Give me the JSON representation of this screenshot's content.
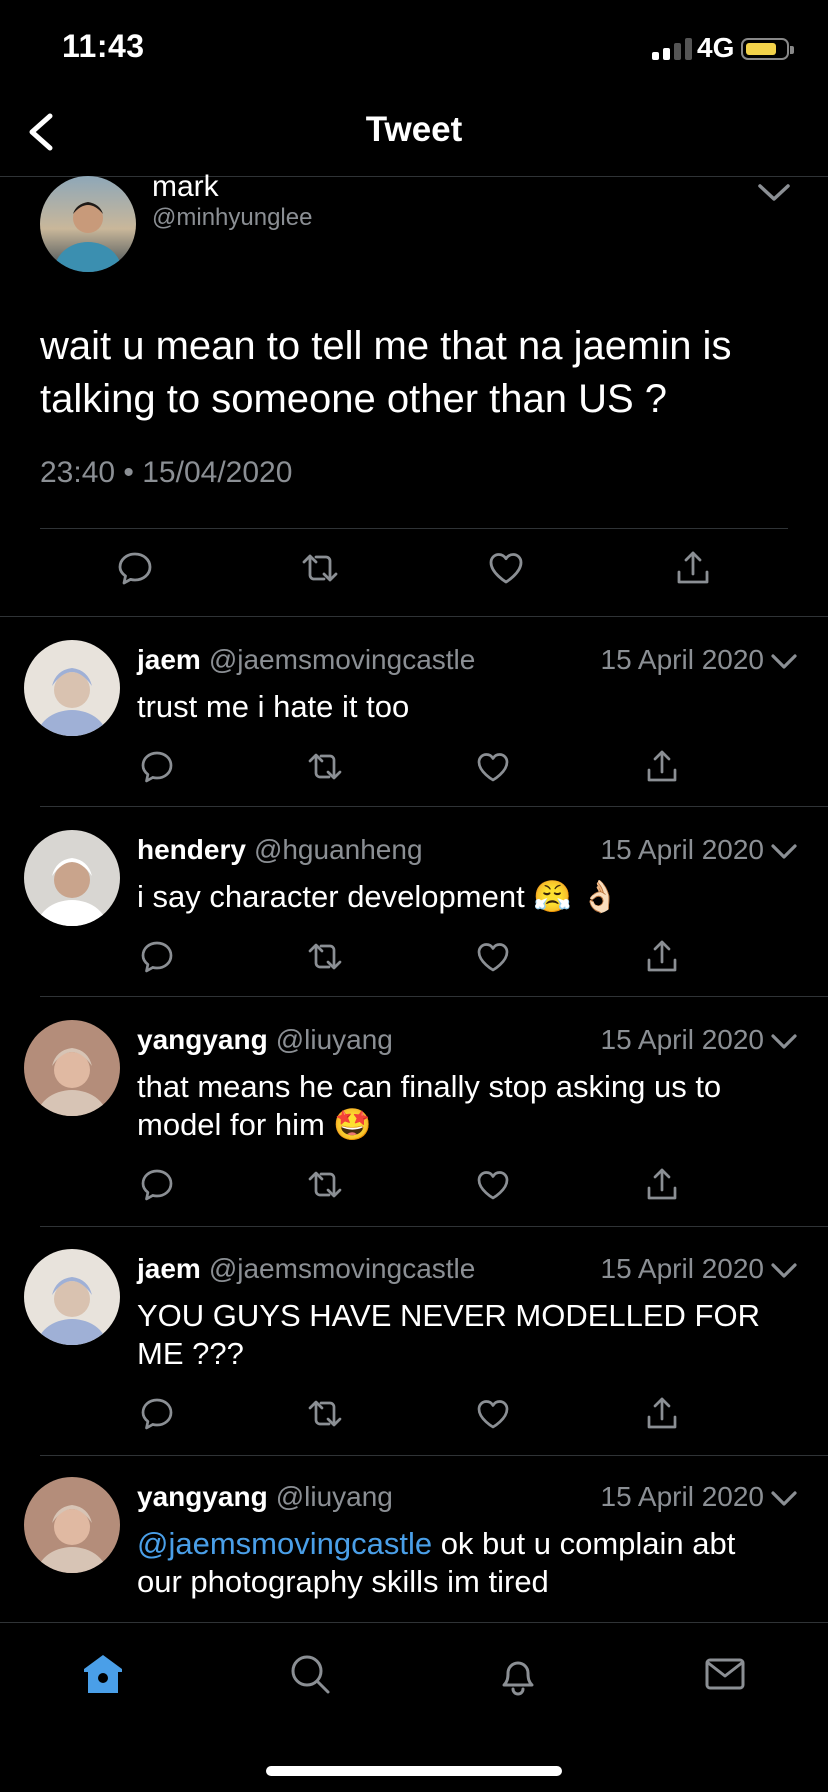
{
  "status_bar": {
    "time": "11:43",
    "network": "4G"
  },
  "header": {
    "title": "Tweet"
  },
  "main_tweet": {
    "name": "mark",
    "handle": "@minhyunglee",
    "text": "wait u mean to tell me that na jaemin is talking to someone other than US ?",
    "meta": "23:40 • 15/04/2020"
  },
  "replies": [
    {
      "name": "jaem",
      "handle": "@jaemsmovingcastle",
      "date": "15 April 2020",
      "mention": "",
      "text": "trust me i hate it too"
    },
    {
      "name": "hendery",
      "handle": "@hguanheng",
      "date": "15 April 2020",
      "mention": "",
      "text": "i say character development 😤 👌🏻"
    },
    {
      "name": "yangyang",
      "handle": "@liuyang",
      "date": "15 April 2020",
      "mention": "",
      "text": "that means he can finally stop asking us to model for him 🤩"
    },
    {
      "name": "jaem",
      "handle": "@jaemsmovingcastle",
      "date": "15 April 2020",
      "mention": "",
      "text": "YOU GUYS HAVE NEVER MODELLED FOR ME ???"
    },
    {
      "name": "yangyang",
      "handle": "@liuyang",
      "date": "15 April 2020",
      "mention": "@jaemsmovingcastle",
      "text": " ok but u complain abt our photography skills im tired"
    }
  ],
  "colors": {
    "accent": "#4a9fe8",
    "muted": "#8b8f94",
    "divider": "#2f3336",
    "battery": "#f2d24a"
  },
  "icons": {
    "tweet_actions": [
      "reply-icon",
      "retweet-icon",
      "like-icon",
      "share-icon"
    ],
    "nav": [
      "home-icon",
      "search-icon",
      "notifications-icon",
      "messages-icon"
    ]
  }
}
